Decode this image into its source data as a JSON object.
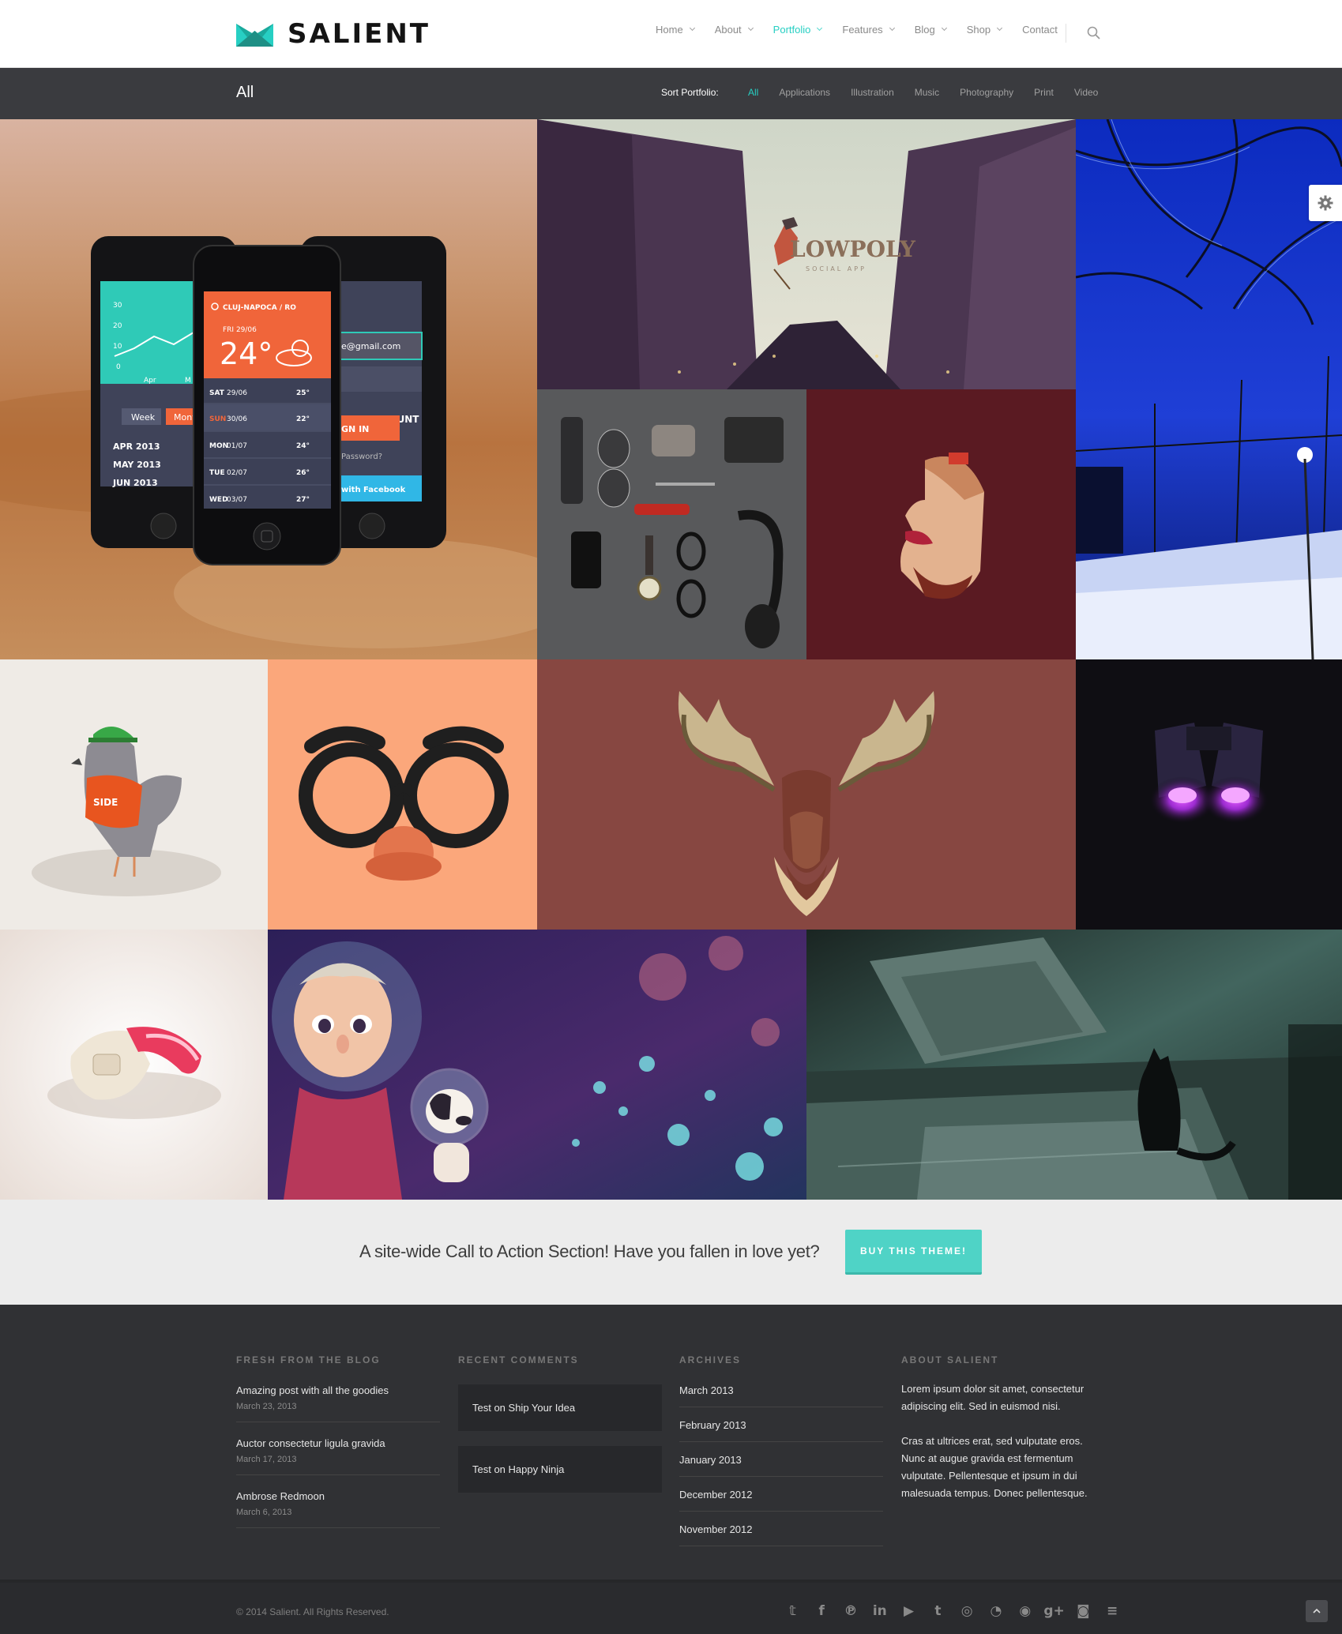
{
  "header": {
    "logo_text": "SALIENT",
    "nav": [
      {
        "label": "Home",
        "dropdown": true
      },
      {
        "label": "About",
        "dropdown": true
      },
      {
        "label": "Portfolio",
        "dropdown": true,
        "active": true
      },
      {
        "label": "Features",
        "dropdown": true
      },
      {
        "label": "Blog",
        "dropdown": true
      },
      {
        "label": "Shop",
        "dropdown": true
      },
      {
        "label": "Contact",
        "dropdown": false
      }
    ],
    "search_icon": "search-icon"
  },
  "filterbar": {
    "title": "All",
    "sort_label": "Sort Portfolio:",
    "filters": [
      "All",
      "Applications",
      "Illustration",
      "Music",
      "Photography",
      "Print",
      "Video"
    ],
    "active_filter": "All"
  },
  "portfolio": {
    "tiles": [
      {
        "name": "tile-weather-app",
        "phone_labels": {
          "city": "CLUJ-NAPOCA / RO",
          "date": "FRI 29/06",
          "temp": "24°",
          "account": "OUR ACCOUNT",
          "email": "e@gmail.com",
          "sign_in": "GN IN",
          "forgot": "Password?",
          "facebook": "with Facebook",
          "week": "Week",
          "month": "Mont",
          "chart_ticks": [
            "30",
            "20",
            "10",
            "0"
          ],
          "chart_x": [
            "Apr",
            "M"
          ],
          "months": [
            "APR 2013",
            "MAY 2013",
            "JUN 2013"
          ],
          "forecast": [
            {
              "day": "SAT",
              "date": "29/06",
              "temp": "25°"
            },
            {
              "day": "SUN",
              "date": "30/06",
              "temp": "22°"
            },
            {
              "day": "MON",
              "date": "01/07",
              "temp": "24°"
            },
            {
              "day": "TUE",
              "date": "02/07",
              "temp": "26°"
            },
            {
              "day": "WED",
              "date": "03/07",
              "temp": "27°"
            }
          ]
        }
      },
      {
        "name": "tile-lowpoly",
        "title": "LOWPOLY",
        "subtitle": "SOCIAL APP"
      },
      {
        "name": "tile-winter-night"
      },
      {
        "name": "tile-accessories"
      },
      {
        "name": "tile-face-illustration"
      },
      {
        "name": "tile-pigeon"
      },
      {
        "name": "tile-glasses"
      },
      {
        "name": "tile-moose"
      },
      {
        "name": "tile-binoculars"
      },
      {
        "name": "tile-device"
      },
      {
        "name": "tile-astronaut"
      },
      {
        "name": "tile-cat"
      }
    ]
  },
  "cta": {
    "text": "A site-wide Call to Action Section! Have you fallen in love yet?",
    "button": "BUY THIS THEME!"
  },
  "footer": {
    "blog": {
      "heading": "FRESH FROM THE BLOG",
      "posts": [
        {
          "title": "Amazing post with all the goodies",
          "date": "March 23, 2013"
        },
        {
          "title": "Auctor consectetur ligula gravida",
          "date": "March 17, 2013"
        },
        {
          "title": "Ambrose Redmoon",
          "date": "March 6, 2013"
        }
      ]
    },
    "comments": {
      "heading": "RECENT COMMENTS",
      "items": [
        "Test on Ship Your Idea",
        "Test on Happy Ninja"
      ]
    },
    "archives": {
      "heading": "ARCHIVES",
      "items": [
        "March 2013",
        "February 2013",
        "January 2013",
        "December 2012",
        "November 2012"
      ]
    },
    "about": {
      "heading": "ABOUT SALIENT",
      "p1": "Lorem ipsum dolor sit amet, consectetur adipiscing elit. Sed in euismod nisi.",
      "p2": "Cras at ultrices erat, sed vulputate eros. Nunc at augue gravida est fermentum vulputate. Pellentesque et ipsum in dui malesuada tempus. Donec pellentesque."
    }
  },
  "bottombar": {
    "copyright": "© 2014 Salient. All Rights Reserved.",
    "socials": [
      "twitter-icon",
      "facebook-icon",
      "pinterest-icon",
      "linkedin-icon",
      "youtube-icon",
      "tumblr-icon",
      "dribbble-icon",
      "rss-icon",
      "github-icon",
      "google-plus-icon",
      "instagram-icon",
      "stackexchange-icon"
    ],
    "social_glyphs": [
      "𝕥",
      "f",
      "℗",
      "in",
      "▶",
      "t",
      "◎",
      "◔",
      "◉",
      "g+",
      "◙",
      "≡"
    ]
  },
  "colors": {
    "accent": "#27cfc3",
    "cta_button": "#4fd3c6",
    "filter_bar": "#3a3b3f",
    "footer": "#303134"
  }
}
